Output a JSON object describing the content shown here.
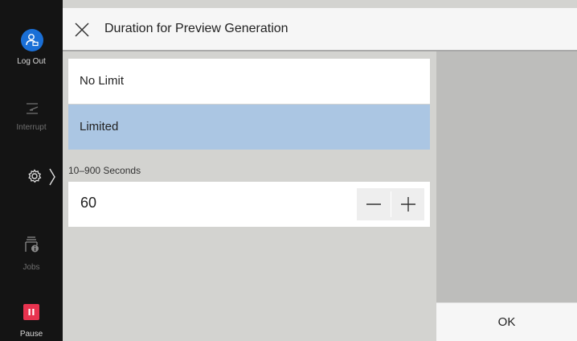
{
  "sidebar": {
    "logout_label": "Log Out",
    "interrupt_label": "Interrupt",
    "jobs_label": "Jobs",
    "pause_label": "Pause",
    "colors": {
      "logout": "#1a6fd6",
      "pause": "#e8334f"
    }
  },
  "header": {
    "title": "Duration for Preview Generation",
    "close_icon": "close-icon"
  },
  "options": [
    {
      "label": "No Limit",
      "selected": false
    },
    {
      "label": "Limited",
      "selected": true
    }
  ],
  "value_field": {
    "range_label": "10–900 Seconds",
    "value": "60"
  },
  "footer": {
    "ok_label": "OK"
  }
}
